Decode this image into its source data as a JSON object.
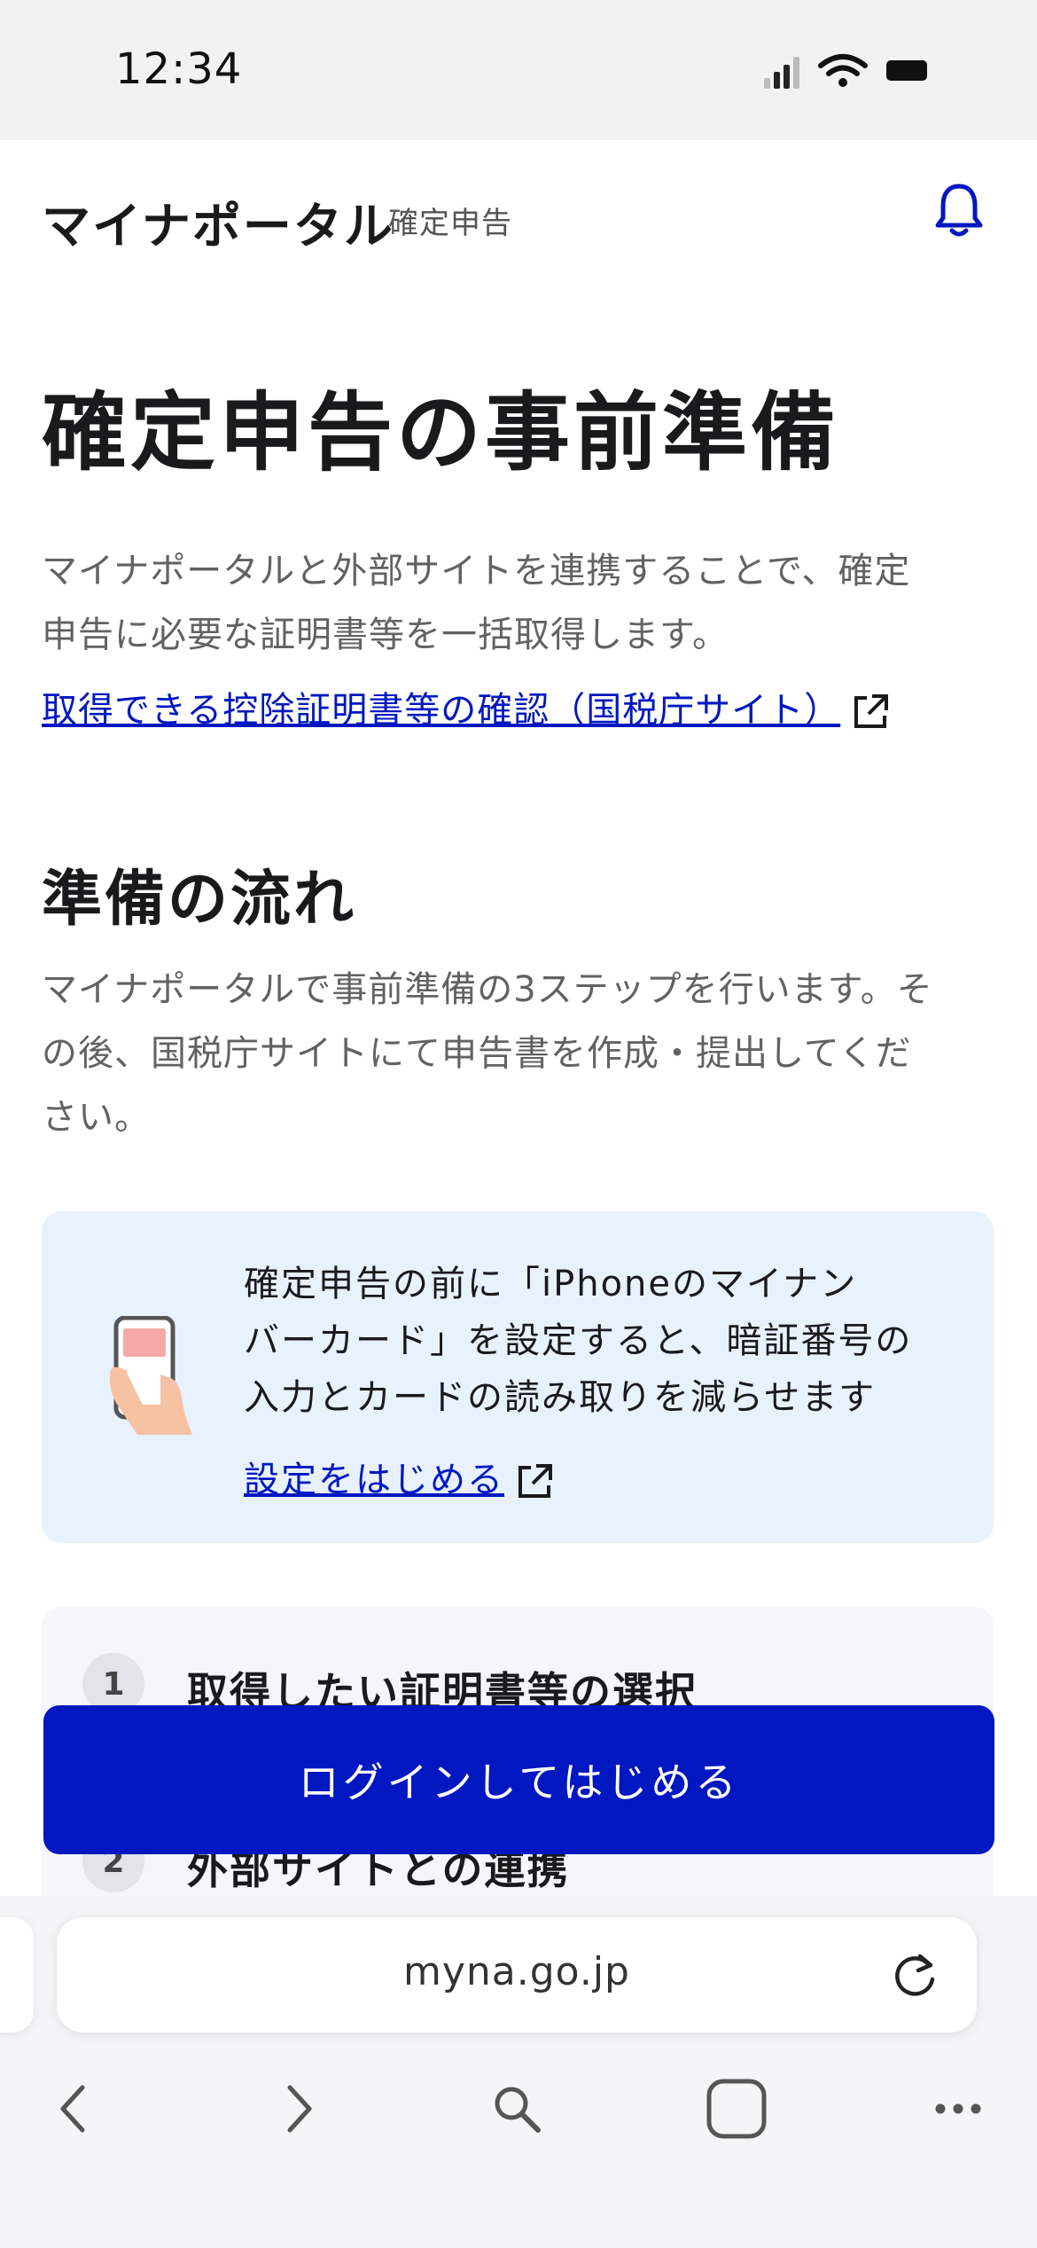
{
  "status_bar": {
    "time": "12:34"
  },
  "header": {
    "brand": "マイナポータル",
    "sub": "確定申告"
  },
  "main": {
    "title": "確定申告の事前準備",
    "intro_lines": [
      "マイナポータルと外部サイトを連携することで、確定",
      "申告に必要な証明書等を一括取得します。"
    ],
    "deduction_link": "取得できる控除証明書等の確認（国税庁サイト）",
    "flow_title": "準備の流れ",
    "flow_lines": [
      "マイナポータルで事前準備の3ステップを行います。そ",
      "の後、国税庁サイトにて申告書を作成・提出してくだ",
      "さい。"
    ]
  },
  "info_card": {
    "lines": [
      "確定申告の前に「iPhoneのマイナン",
      "バーカード」を設定すると、暗証番号の",
      "入力とカードの読み取りを減らせます"
    ],
    "link": "設定をはじめる"
  },
  "steps": [
    {
      "num": "1",
      "label": "取得したい証明書等の選択"
    },
    {
      "num": "2",
      "label": "外部サイトとの連携"
    }
  ],
  "cta": {
    "label": "ログインしてはじめる"
  },
  "browser": {
    "url": "myna.go.jp"
  },
  "colors": {
    "accent": "#0017c1",
    "info_bg": "#e8f1fe",
    "text": "#1a1a1c",
    "muted": "#626264"
  },
  "icons": [
    "bell-icon",
    "external-link-icon",
    "phone-card-icon",
    "reload-icon",
    "back-icon",
    "forward-icon",
    "search-icon",
    "tabs-icon",
    "more-icon"
  ]
}
